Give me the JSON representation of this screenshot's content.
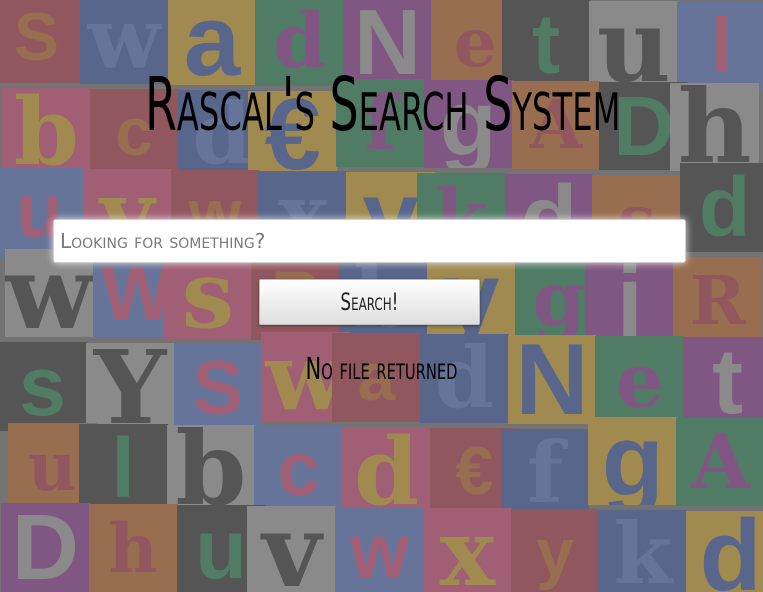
{
  "page": {
    "title": "Rascal's Search System"
  },
  "search": {
    "placeholder": "Looking for something?",
    "value": "",
    "button_label": "Search!"
  },
  "result": {
    "status": "No file returned"
  },
  "background": {
    "letters": [
      "S",
      "w",
      "a",
      "d",
      "N",
      "e",
      "t",
      "u",
      "l",
      "b",
      "c",
      "d",
      "€",
      "f",
      "g",
      "A",
      "D",
      "h",
      "u",
      "v",
      "w",
      "x",
      "y",
      "k",
      "d",
      "s",
      "d",
      "w",
      "W",
      "s",
      "R",
      "b",
      "y",
      "g",
      "j",
      "R",
      "s",
      "Y"
    ],
    "colors": [
      "#b03040",
      "#3050a0",
      "#d0a020",
      "#208050",
      "#8a3090",
      "#c06020",
      "#2a2a2a",
      "#a0a0a0",
      "#5070c0",
      "#d04070"
    ]
  }
}
